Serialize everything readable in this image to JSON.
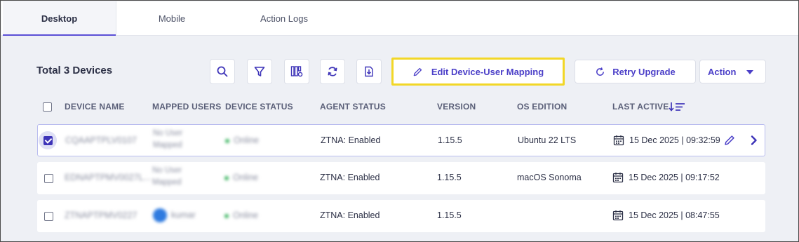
{
  "tabs": [
    {
      "label": "Desktop",
      "active": true
    },
    {
      "label": "Mobile",
      "active": false
    },
    {
      "label": "Action Logs",
      "active": false
    }
  ],
  "heading": "Total 3 Devices",
  "toolbar": {
    "icons": [
      "search-icon",
      "filter-icon",
      "columns-settings-icon",
      "refresh-icon",
      "export-icon"
    ],
    "edit_mapping_label": "Edit Device-User Mapping",
    "retry_upgrade_label": "Retry Upgrade",
    "action_label": "Action"
  },
  "table": {
    "headers": {
      "device_name": "DEVICE NAME",
      "mapped_users": "MAPPED USERS",
      "device_status": "DEVICE STATUS",
      "agent_status": "AGENT STATUS",
      "version": "VERSION",
      "os_edition": "OS EDITION",
      "last_active": "LAST ACTIVE"
    },
    "rows": [
      {
        "selected": true,
        "device_name": "CQAAPTPLV0107",
        "mapped_user_line1": "No User",
        "mapped_user_line2": "Mapped",
        "device_status": "Online",
        "agent_status": "ZTNA: Enabled",
        "version": "1.15.5",
        "os_edition": "Ubuntu 22 LTS",
        "last_active": "15 Dec 2025 | 09:32:59"
      },
      {
        "selected": false,
        "device_name": "EDNAPTPMV0027L...",
        "mapped_user_line1": "No User",
        "mapped_user_line2": "Mapped",
        "device_status": "Online",
        "agent_status": "ZTNA: Enabled",
        "version": "1.15.5",
        "os_edition": "macOS Sonoma",
        "last_active": "15 Dec 2025 | 09:17:52"
      },
      {
        "selected": false,
        "device_name": "ZTNAPTPMV0227",
        "mapped_user_line1": "kumar",
        "device_status": "Online",
        "agent_status": "ZTNA: Enabled",
        "version": "1.15.5",
        "os_edition": "",
        "last_active": "15 Dec 2025 | 08:47:55"
      }
    ]
  },
  "colors": {
    "accent": "#4b3fc8",
    "highlight_border": "#f2d727",
    "online": "#35b25b",
    "background": "#eef0f5"
  }
}
